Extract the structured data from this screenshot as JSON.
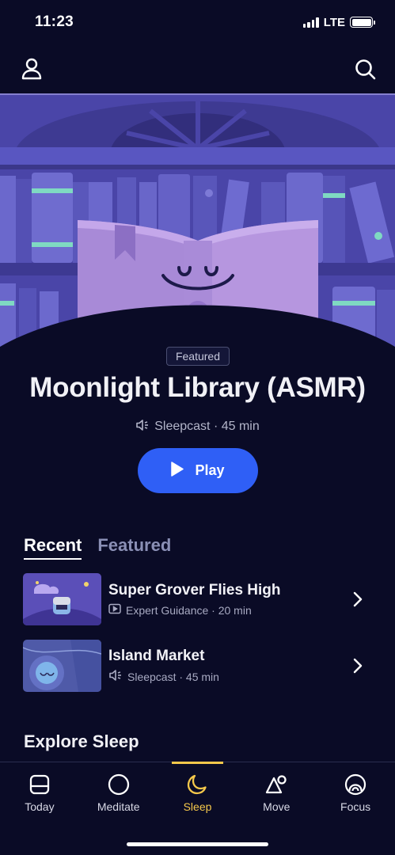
{
  "status_bar": {
    "time": "11:23",
    "network": "LTE"
  },
  "hero": {
    "badge": "Featured",
    "title": "Moonlight Library (ASMR)",
    "meta": "Sleepcast · 45 min",
    "play_label": "Play"
  },
  "tabs": [
    {
      "label": "Recent",
      "active": true
    },
    {
      "label": "Featured",
      "active": false
    }
  ],
  "recent_items": [
    {
      "title": "Super Grover Flies High",
      "meta": "Expert Guidance · 20 min",
      "type_icon": "video-icon"
    },
    {
      "title": "Island Market",
      "meta": "Sleepcast · 45 min",
      "type_icon": "speaker-icon"
    }
  ],
  "explore_title": "Explore Sleep",
  "tab_bar": [
    {
      "label": "Today",
      "icon": "today-icon",
      "selected": false
    },
    {
      "label": "Meditate",
      "icon": "meditate-icon",
      "selected": false
    },
    {
      "label": "Sleep",
      "icon": "moon-icon",
      "selected": true
    },
    {
      "label": "Move",
      "icon": "move-icon",
      "selected": false
    },
    {
      "label": "Focus",
      "icon": "focus-icon",
      "selected": false
    }
  ],
  "colors": {
    "background": "#0a0b26",
    "accent": "#2f5ff6",
    "selected_tab": "#f5c84b"
  }
}
